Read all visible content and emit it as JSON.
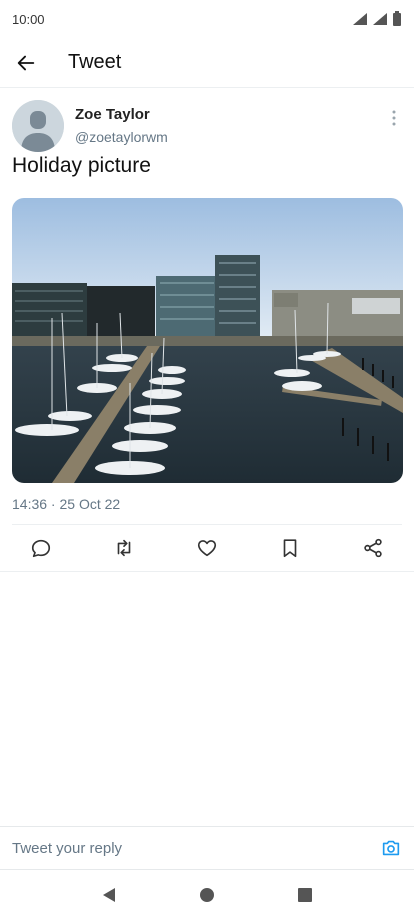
{
  "status_bar": {
    "time": "10:00"
  },
  "app_bar": {
    "title": "Tweet"
  },
  "tweet": {
    "author_name": "Zoe Taylor",
    "author_handle": "@zoetaylorwm",
    "text": "Holiday picture",
    "timestamp": "14:36 · 25 Oct 22"
  },
  "actions": [
    "reply-icon",
    "retweet-icon",
    "like-icon",
    "bookmark-icon",
    "share-icon"
  ],
  "reply_bar": {
    "placeholder": "Tweet your reply"
  },
  "colors": {
    "accent": "#1d9bf0",
    "muted": "#657786"
  }
}
